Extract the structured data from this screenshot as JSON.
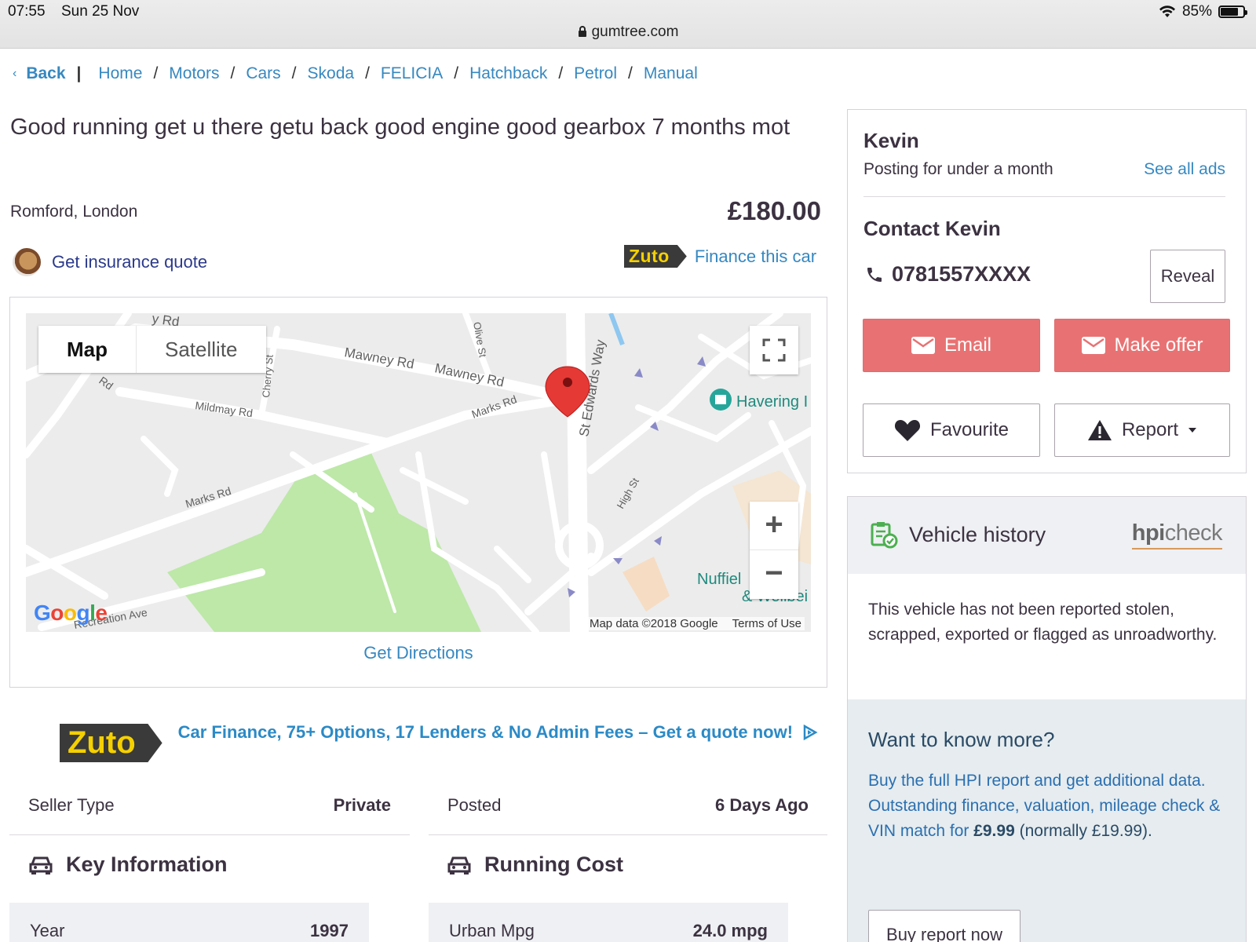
{
  "status_bar": {
    "time": "07:55",
    "date": "Sun 25 Nov",
    "battery": "85%"
  },
  "browser": {
    "url": "gumtree.com"
  },
  "breadcrumb": {
    "back_label": "Back",
    "items": [
      "Home",
      "Motors",
      "Cars",
      "Skoda",
      "FELICIA",
      "Hatchback",
      "Petrol",
      "Manual"
    ]
  },
  "listing": {
    "title": "Good running get u there getu back good engine good gearbox 7 months mot",
    "location": "Romford, London",
    "price": "£180.00",
    "insurance_link": "Get insurance quote",
    "finance_badge": "Zuto",
    "finance_link": "Finance this car"
  },
  "map": {
    "tab_map": "Map",
    "tab_satellite": "Satellite",
    "zoom_in": "+",
    "zoom_out": "−",
    "attribution": "Map data ©2018 Google",
    "terms": "Terms of Use",
    "logo": "Google",
    "poi_havering": "Havering I",
    "poi_nuffield": "Nuffiel",
    "poi_nuffield2": "& Wellbei",
    "roads": {
      "mawney1": "Mawney Rd",
      "mawney2": "Mawney Rd",
      "mildmay": "Mildmay Rd",
      "marks1": "Marks Rd",
      "marks2": "Marks Rd",
      "stedwards": "St Edwards Way",
      "olive": "Olive St",
      "cherry": "Cherry St",
      "high": "High St",
      "recreation": "Recreation Ave",
      "rd_top": "y Rd",
      "rd_left": "Rd"
    },
    "directions_link": "Get Directions"
  },
  "zuto_banner": {
    "logo": "Zuto",
    "text": "Car Finance, 75+ Options, 17 Lenders & No Admin Fees – Get a quote now!"
  },
  "attributes": {
    "seller_type_label": "Seller Type",
    "seller_type_value": "Private",
    "posted_label": "Posted",
    "posted_value": "6 Days Ago"
  },
  "key_info": {
    "title": "Key Information",
    "rows": [
      {
        "label": "Year",
        "value": "1997"
      }
    ]
  },
  "running_cost": {
    "title": "Running Cost",
    "rows": [
      {
        "label": "Urban Mpg",
        "value": "24.0  mpg"
      }
    ]
  },
  "seller": {
    "name": "Kevin",
    "posting_for": "Posting for under a month",
    "see_all": "See all ads",
    "contact_title": "Contact Kevin",
    "phone": "0781557XXXX",
    "reveal": "Reveal",
    "email": "Email",
    "make_offer": "Make offer",
    "favourite": "Favourite",
    "report": "Report"
  },
  "vehicle_history": {
    "title": "Vehicle history",
    "logo_bold": "hpi",
    "logo_light": "check",
    "status": "This vehicle has not been reported stolen, scrapped, exported or flagged as unroadworthy.",
    "more_title": "Want to know more?",
    "more_line1": "Buy the full HPI report and get additional data.",
    "more_line2a": "Outstanding finance, valuation, mileage check & VIN match for ",
    "more_price": "£9.99",
    "more_line2b": " (normally £19.99).",
    "buy_button": "Buy report now"
  },
  "colors": {
    "link": "#3688c0",
    "red_button": "#e87273",
    "zuto_yellow": "#f5d000",
    "park_green": "#bde8a8"
  }
}
